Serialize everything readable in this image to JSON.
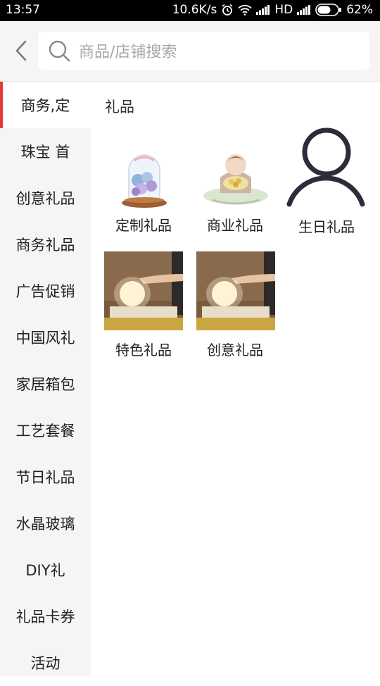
{
  "status_bar": {
    "time": "13:57",
    "network_speed": "10.6K/s",
    "network_type": "HD",
    "battery": "62%"
  },
  "search": {
    "placeholder": "商品/店铺搜索"
  },
  "sidebar": {
    "active_index": 0,
    "items": [
      {
        "label": "商务,定"
      },
      {
        "label": "珠宝 首"
      },
      {
        "label": "创意礼品"
      },
      {
        "label": "商务礼品"
      },
      {
        "label": "广告促销"
      },
      {
        "label": "中国风礼"
      },
      {
        "label": "家居箱包"
      },
      {
        "label": "工艺套餐"
      },
      {
        "label": "节日礼品"
      },
      {
        "label": "水晶玻璃"
      },
      {
        "label": "DIY礼"
      },
      {
        "label": "礼品卡券"
      },
      {
        "label": "活动"
      }
    ]
  },
  "main": {
    "section_title": "礼品",
    "tiles": [
      {
        "label": "定制礼品",
        "icon": "flower-dome-image"
      },
      {
        "label": "商业礼品",
        "icon": "girl-bouquet-image"
      },
      {
        "label": "生日礼品",
        "icon": "user-placeholder-icon"
      },
      {
        "label": "特色礼品",
        "icon": "moon-lamp-image"
      },
      {
        "label": "创意礼品",
        "icon": "moon-lamp-image"
      }
    ]
  },
  "colors": {
    "accent": "#e4393c",
    "sidebar_bg": "#f5f5f5",
    "status_bar_bg": "#000000"
  }
}
